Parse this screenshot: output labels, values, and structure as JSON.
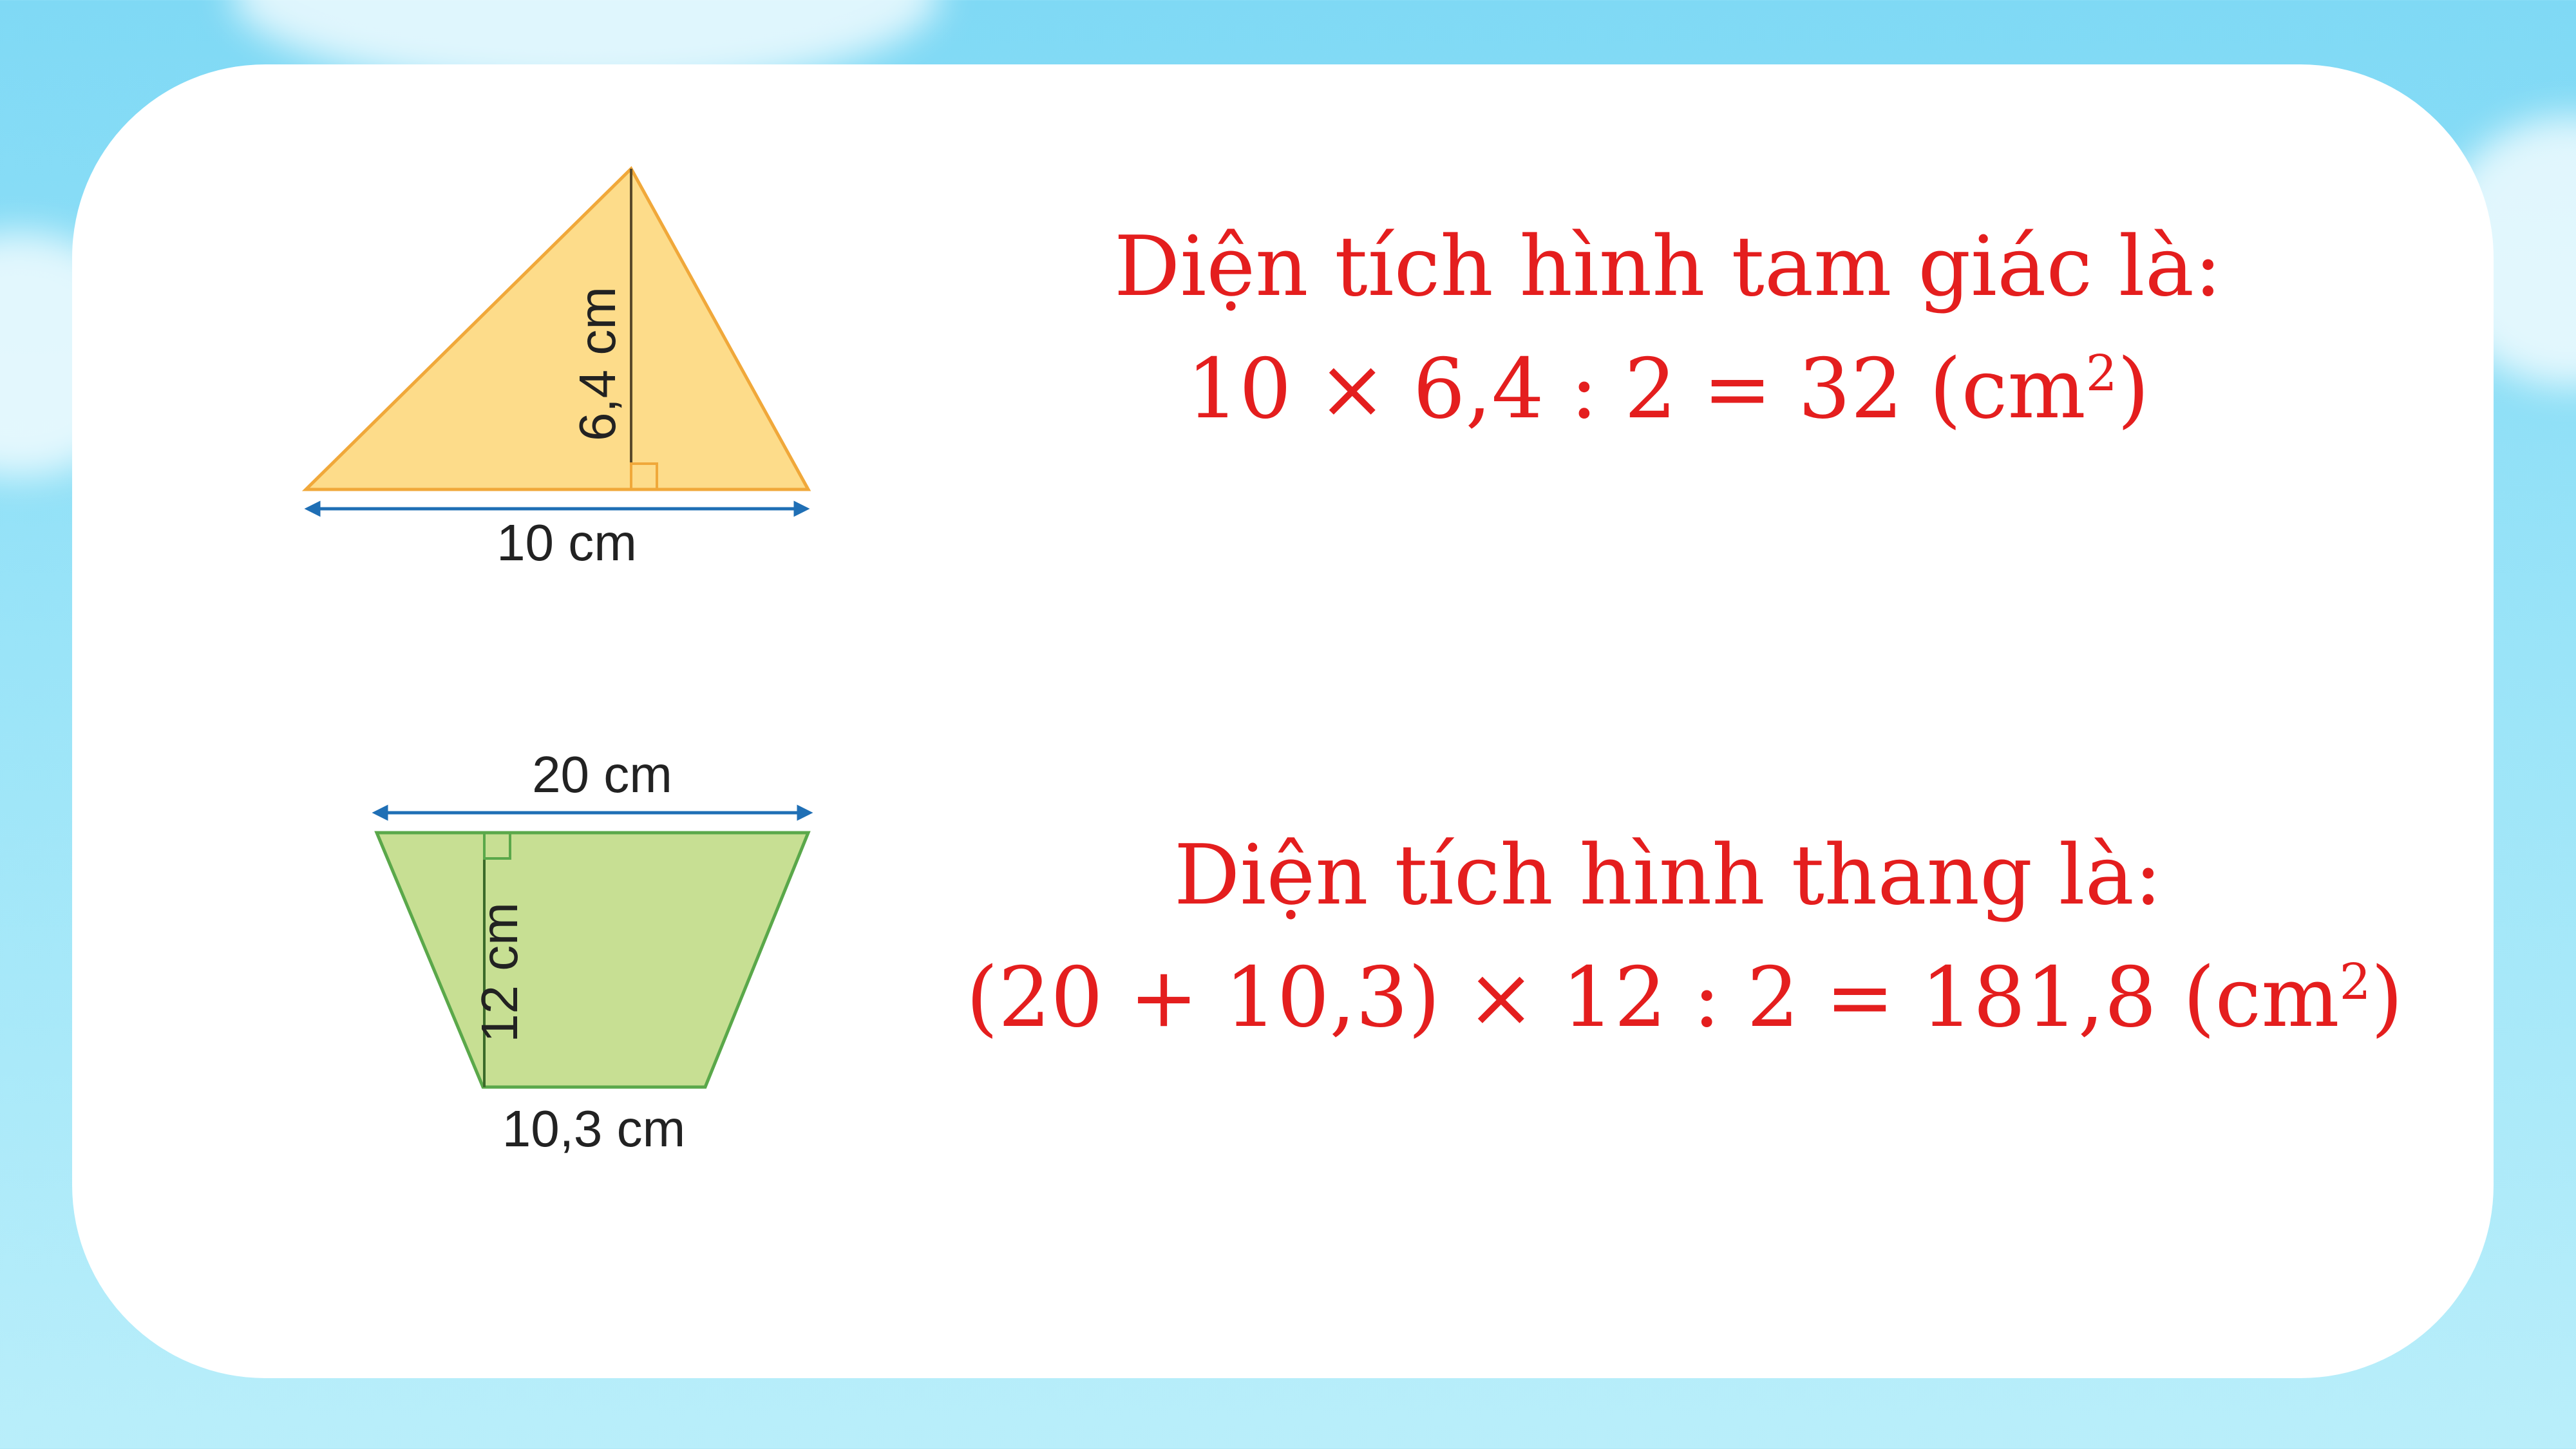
{
  "triangle": {
    "height_label": "6,4 cm",
    "base_label": "10 cm",
    "fill": "#fddc8a",
    "stroke": "#f0a83a"
  },
  "trapezoid": {
    "top_label": "20 cm",
    "height_label": "12 cm",
    "bottom_label": "10,3 cm",
    "fill": "#c7df93",
    "stroke": "#5aa84a"
  },
  "formula_triangle": {
    "heading": "Diện tích hình tam giác là:",
    "expression": "10 × 6,4 : 2 = 32 (cm",
    "unit_power": "2",
    "close": ")"
  },
  "formula_trapezoid": {
    "heading": "Diện tích hình thang là:",
    "expression": "(20 + 10,3) × 12 : 2 = 181,8 (cm",
    "unit_power": "2",
    "close": ")"
  },
  "colors": {
    "formula_text": "#e41e1e",
    "arrow": "#1f6fb5",
    "background": "#8fdff7"
  }
}
